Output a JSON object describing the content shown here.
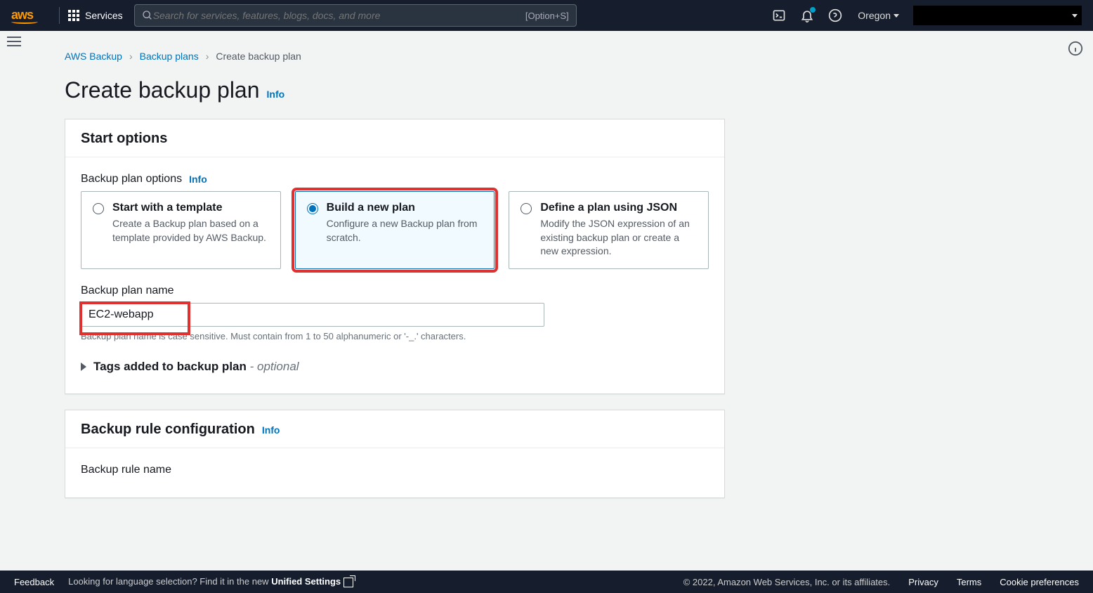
{
  "nav": {
    "logo": "aws",
    "services": "Services",
    "search_placeholder": "Search for services, features, blogs, docs, and more",
    "search_shortcut": "[Option+S]",
    "region": "Oregon"
  },
  "breadcrumbs": {
    "root": "AWS Backup",
    "plans": "Backup plans",
    "current": "Create backup plan"
  },
  "page": {
    "title": "Create backup plan",
    "info": "Info"
  },
  "start_options": {
    "heading": "Start options",
    "options_label": "Backup plan options",
    "info": "Info",
    "cards": [
      {
        "title": "Start with a template",
        "desc": "Create a Backup plan based on a template provided by AWS Backup."
      },
      {
        "title": "Build a new plan",
        "desc": "Configure a new Backup plan from scratch."
      },
      {
        "title": "Define a plan using JSON",
        "desc": "Modify the JSON expression of an existing backup plan or create a new expression."
      }
    ],
    "name_label": "Backup plan name",
    "name_value": "EC2-webapp",
    "name_hint": "Backup plan name is case sensitive. Must contain from 1 to 50 alphanumeric or '-_.' characters.",
    "tags_label": "Tags added to backup plan",
    "tags_optional": "- optional"
  },
  "rule_config": {
    "heading": "Backup rule configuration",
    "info": "Info",
    "rule_name_label": "Backup rule name"
  },
  "footer": {
    "feedback": "Feedback",
    "lang_prompt": "Looking for language selection? Find it in the new ",
    "unified": "Unified Settings",
    "copyright": "© 2022, Amazon Web Services, Inc. or its affiliates.",
    "privacy": "Privacy",
    "terms": "Terms",
    "cookies": "Cookie preferences"
  }
}
